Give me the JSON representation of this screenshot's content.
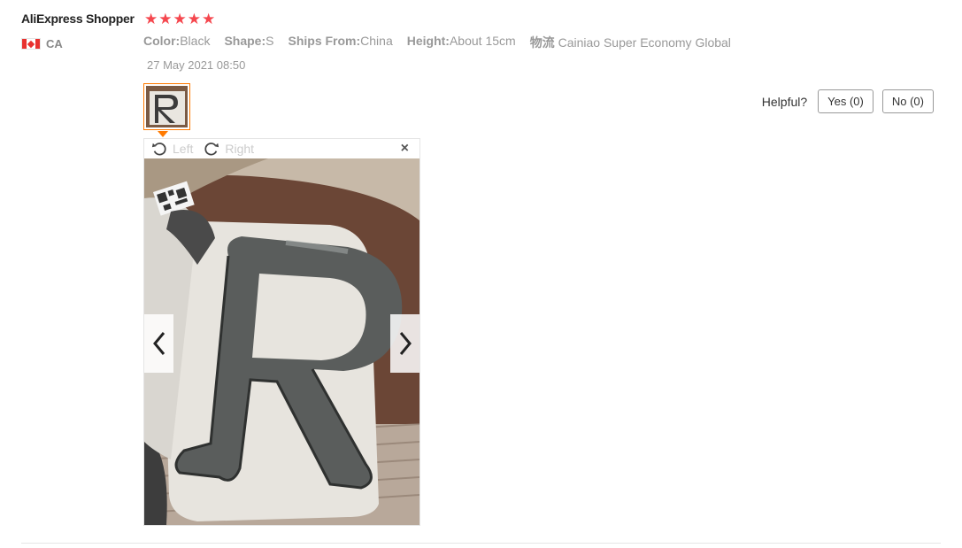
{
  "review": {
    "user_name": "AliExpress Shopper",
    "country_code": "CA",
    "rating_stars": 5,
    "date": "27 May 2021 08:50",
    "properties": [
      {
        "key": "Color:",
        "value": "Black"
      },
      {
        "key": "Shape:",
        "value": "S"
      },
      {
        "key": "Ships From:",
        "value": "China"
      },
      {
        "key": "Height:",
        "value": "About 15cm"
      },
      {
        "key": "物流",
        "value": "Cainiao Super Economy Global"
      }
    ],
    "star_color": "#f5474e"
  },
  "helpful": {
    "label": "Helpful?",
    "yes_label": "Yes (0)",
    "no_label": "No (0)"
  },
  "viewer": {
    "rotate_left_label": "Left",
    "rotate_right_label": "Right",
    "close_glyph": "×",
    "accent_color": "#ff7a00"
  },
  "icons": {
    "flag": "canada-flag-icon",
    "rotate_left": "rotate-left-icon",
    "rotate_right": "rotate-right-icon",
    "close": "close-icon",
    "prev": "chevron-left-icon",
    "next": "chevron-right-icon"
  }
}
